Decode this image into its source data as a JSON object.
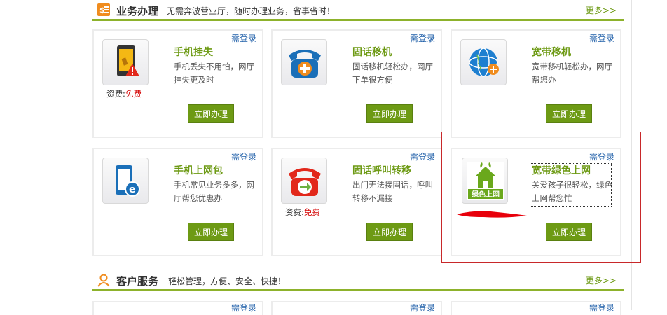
{
  "business": {
    "title": "业务办理",
    "subtitle": "无需奔波营业厅，随时办理业务，省事省时！",
    "more": "更多>>"
  },
  "customer": {
    "title": "客户服务",
    "subtitle": "轻松管理，方便、安全、快捷！",
    "more": "更多>>"
  },
  "cards": [
    {
      "title": "手机挂失",
      "desc": "手机丢失不用怕，网厅挂失更及时",
      "login": "需登录",
      "button": "立即办理",
      "fee_label": "资费:",
      "fee_value": "免费"
    },
    {
      "title": "固话移机",
      "desc": "固话移机轻松办，网厅下单很方便",
      "login": "需登录",
      "button": "立即办理"
    },
    {
      "title": "宽带移机",
      "desc": "宽带移机轻松办，网厅帮您办",
      "login": "需登录",
      "button": "立即办理"
    },
    {
      "title": "手机上网包",
      "desc": "手机常见业务多多，网厅帮您优惠办",
      "login": "需登录",
      "button": "立即办理"
    },
    {
      "title": "固话呼叫转移",
      "desc": "出门无法接固话，呼叫转移不漏接",
      "login": "需登录",
      "button": "立即办理",
      "fee_label": "资费:",
      "fee_value": "免费"
    },
    {
      "title": "宽带绿色上网",
      "desc": "关爱孩子很轻松，绿色上网帮您忙",
      "login": "需登录",
      "button": "立即办理",
      "icon_text": "绿色上网"
    }
  ],
  "bottom_cards": [
    {
      "login": "需登录"
    },
    {
      "login": "需登录"
    },
    {
      "login": "需登录"
    }
  ]
}
